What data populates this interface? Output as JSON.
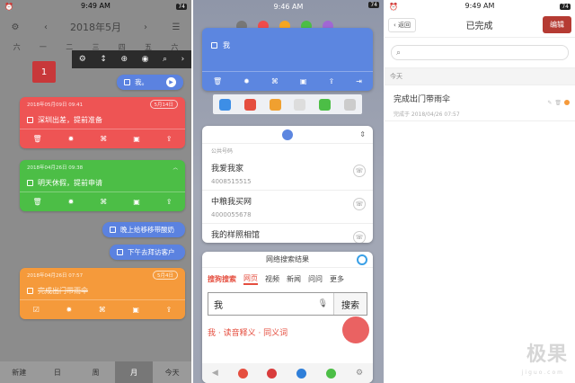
{
  "status": {
    "time1": "9:49 AM",
    "time2": "9:46 AM",
    "time3": "9:49 AM",
    "battery": "74"
  },
  "calendar": {
    "month_title": "2018年5月",
    "week_labels": [
      "六",
      "一",
      "二",
      "三",
      "四",
      "五",
      "六"
    ],
    "day1": "1",
    "toolbar_icons": [
      "gear-icon",
      "updown-icon",
      "plus-icon",
      "eye-icon",
      "search-icon",
      "chevron-right-icon"
    ]
  },
  "notes": [
    {
      "id": "a",
      "meta": "2018年05月09日 09:41",
      "tag": "5月14日",
      "text": "深圳出差，提前准备",
      "color": "#ee5454"
    },
    {
      "id": "b",
      "meta": "2018年04月26日 09:38",
      "tag": "",
      "text": "明天休假，提前申请",
      "color": "#4cbe46"
    },
    {
      "id": "c",
      "meta": "2018年04月26日 07:57",
      "tag": "5月4日",
      "text": "完成出门带雨伞",
      "color": "#f59a3b"
    }
  ],
  "pills": {
    "me": "我。",
    "night": "晚上给移移带酸奶",
    "afternoon": "下午去拜访客户"
  },
  "bottom_tabs": [
    "新建",
    "日",
    "周",
    "月",
    "今天"
  ],
  "panel2": {
    "blue_card_text": "我",
    "contacts_section_label": "公共号码",
    "contacts": [
      {
        "name": "我爱我家",
        "phone": "4008515515"
      },
      {
        "name": "中粮我买网",
        "phone": "4000055678"
      },
      {
        "name": "我的样照相馆",
        "phone": ""
      }
    ],
    "web_search_title": "网络搜索结果",
    "engine": "搜狗搜索",
    "search_tabs": [
      "网页",
      "视频",
      "新闻",
      "问问",
      "更多"
    ],
    "search_query": "我",
    "search_button": "搜索",
    "result_preview": "我 · 读音释义 · 同义词"
  },
  "panel3": {
    "back_label": "返回",
    "title": "已完成",
    "edit_label": "编辑",
    "section": "今天",
    "done_item_title": "完成出门带雨伞",
    "done_item_meta": "完成于 2018/04/26 07:57"
  },
  "watermark": {
    "brand": "极果",
    "site": "jiguo.com"
  },
  "colors": {
    "accent_blue": "#5c86e0",
    "red": "#ee5454",
    "green": "#4cbe46",
    "orange": "#f59a3b",
    "edit_red": "#b53b33"
  }
}
